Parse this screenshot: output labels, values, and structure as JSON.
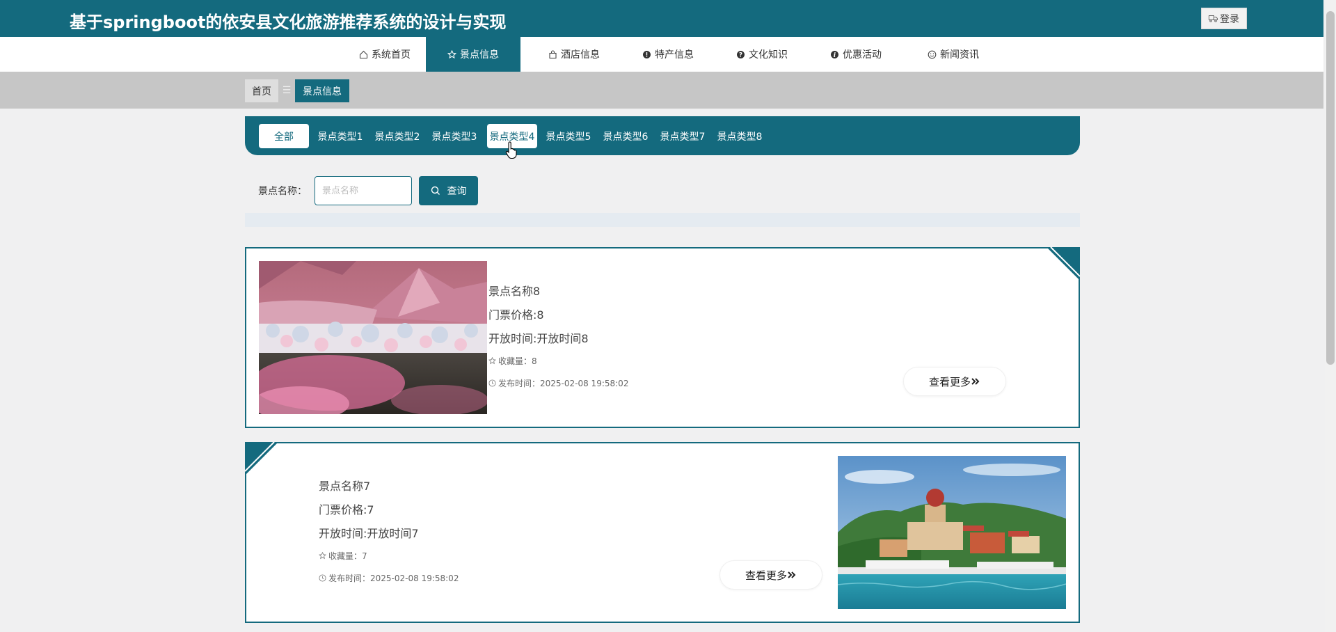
{
  "header": {
    "site_title": "基于springboot的依安县文化旅游推荐系统的设计与实现",
    "login_label": "登录"
  },
  "nav": {
    "items": [
      {
        "label": "系统首页",
        "icon": "home-icon"
      },
      {
        "label": "景点信息",
        "icon": "star-icon",
        "active": true
      },
      {
        "label": "酒店信息",
        "icon": "bag-icon"
      },
      {
        "label": "特产信息",
        "icon": "info-icon"
      },
      {
        "label": "文化知识",
        "icon": "question-icon"
      },
      {
        "label": "优惠活动",
        "icon": "info-icon"
      },
      {
        "label": "新闻资讯",
        "icon": "smile-icon"
      }
    ]
  },
  "breadcrumb": {
    "home": "首页",
    "separator": "☰",
    "current": "景点信息"
  },
  "categories": {
    "items": [
      "全部",
      "景点类型1",
      "景点类型2",
      "景点类型3",
      "景点类型4",
      "景点类型5",
      "景点类型6",
      "景点类型7",
      "景点类型8"
    ],
    "selected": "全部",
    "hovered": "景点类型4"
  },
  "search": {
    "label": "景点名称：",
    "placeholder": "景点名称",
    "value": "",
    "button_label": "查询"
  },
  "listings": [
    {
      "name": "景点名称8",
      "price": "门票价格:8",
      "open_time": "开放时间:开放时间8",
      "favorites": "收藏量：8",
      "published": "发布时间：2025-02-08 19:58:02",
      "more": "查看更多"
    },
    {
      "name": "景点名称7",
      "price": "门票价格:7",
      "open_time": "开放时间:开放时间7",
      "favorites": "收藏量：7",
      "published": "发布时间：2025-02-08 19:58:02",
      "more": "查看更多"
    }
  ],
  "colors": {
    "primary": "#146a7e",
    "page_bg": "#f0f0f1",
    "breadcrumb_bg": "#c6c6c6"
  }
}
